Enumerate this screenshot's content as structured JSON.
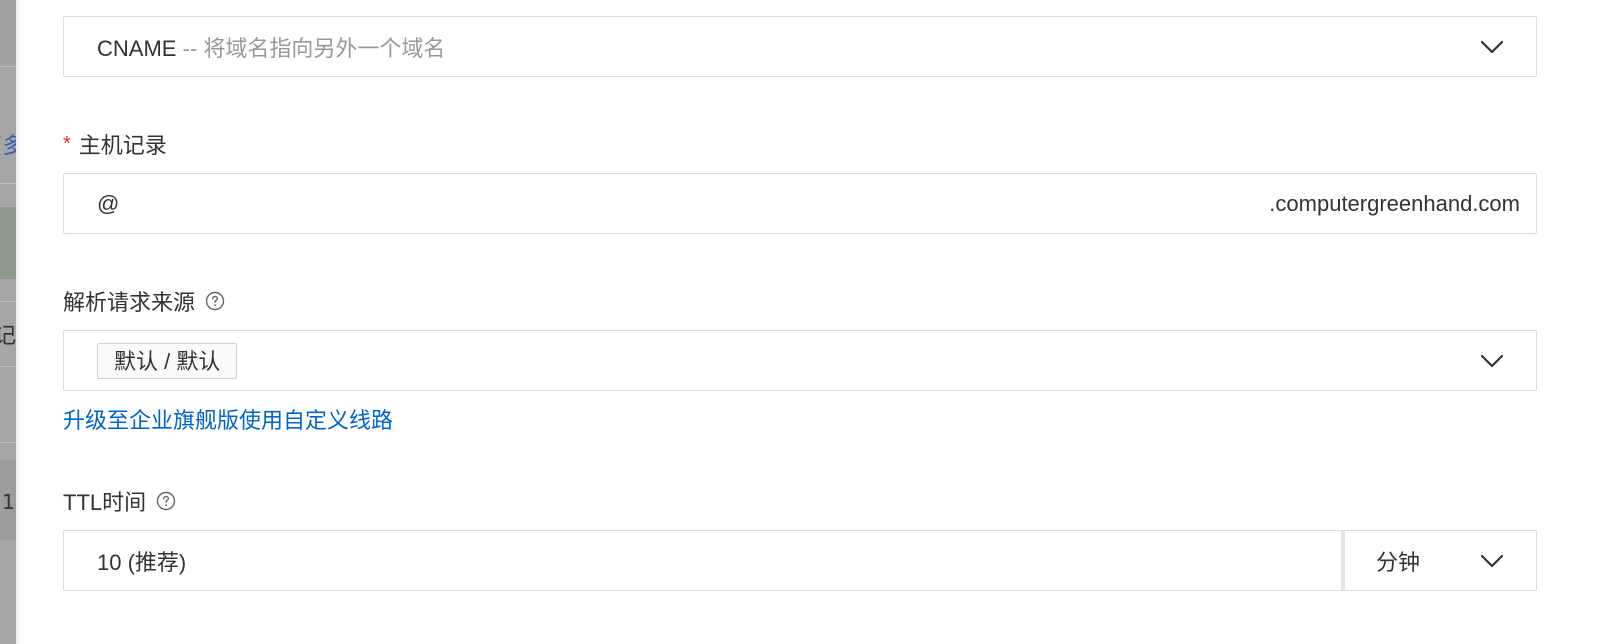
{
  "record_type": {
    "value": "CNAME",
    "separator": "--",
    "description": "将域名指向另外一个域名"
  },
  "host_record": {
    "required_mark": "*",
    "label": "主机记录",
    "value": "@",
    "suffix": ".computergreenhand.com"
  },
  "resolve_source": {
    "label": "解析请求来源",
    "selected_tag": "默认 / 默认",
    "upgrade_link": "升级至企业旗舰版使用自定义线路"
  },
  "ttl": {
    "label": "TTL时间",
    "value": "10 (推荐)",
    "unit": "分钟"
  },
  "background_peek": {
    "items": [
      "[多",
      "记",
      "1"
    ]
  },
  "colors": {
    "link": "#0064c8",
    "required": "#d93026",
    "border": "#dcdcdc",
    "muted_text": "#999999"
  }
}
